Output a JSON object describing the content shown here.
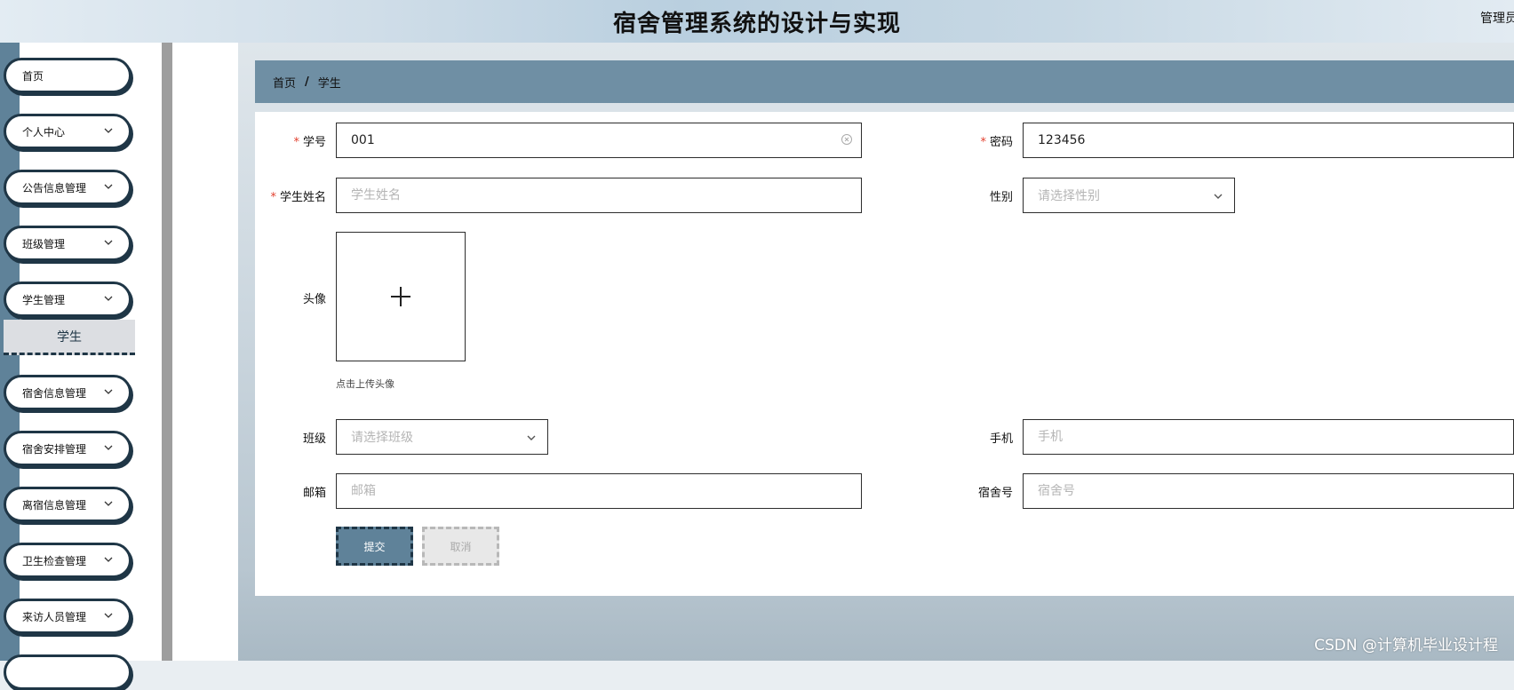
{
  "header": {
    "title": "宿舍管理系统的设计与实现",
    "user": "管理员"
  },
  "sidebar": {
    "items": [
      {
        "label": "首页"
      },
      {
        "label": "个人中心"
      },
      {
        "label": "公告信息管理"
      },
      {
        "label": "班级管理"
      },
      {
        "label": "学生管理"
      },
      {
        "label": "宿舍信息管理"
      },
      {
        "label": "宿舍安排管理"
      },
      {
        "label": "离宿信息管理"
      },
      {
        "label": "卫生检查管理"
      },
      {
        "label": "来访人员管理"
      }
    ],
    "subitem": "学生"
  },
  "breadcrumb": {
    "home": "首页",
    "separator": "/",
    "current": "学生"
  },
  "form": {
    "student_no": {
      "label": "学号",
      "value": "001"
    },
    "password": {
      "label": "密码",
      "value": "123456"
    },
    "student_name": {
      "label": "学生姓名",
      "placeholder": "学生姓名"
    },
    "gender": {
      "label": "性别",
      "placeholder": "请选择性别"
    },
    "avatar": {
      "label": "头像",
      "hint": "点击上传头像"
    },
    "class": {
      "label": "班级",
      "placeholder": "请选择班级"
    },
    "phone": {
      "label": "手机",
      "placeholder": "手机"
    },
    "email": {
      "label": "邮箱",
      "placeholder": "邮箱"
    },
    "dorm_no": {
      "label": "宿舍号",
      "placeholder": "宿舍号"
    },
    "required_mark": "*",
    "submit": "提交",
    "cancel": "取消"
  },
  "watermark": "CSDN @计算机毕业设计程",
  "colors": {
    "accent": "#5f8299",
    "dark": "#1f3646",
    "required": "#e2402f"
  }
}
